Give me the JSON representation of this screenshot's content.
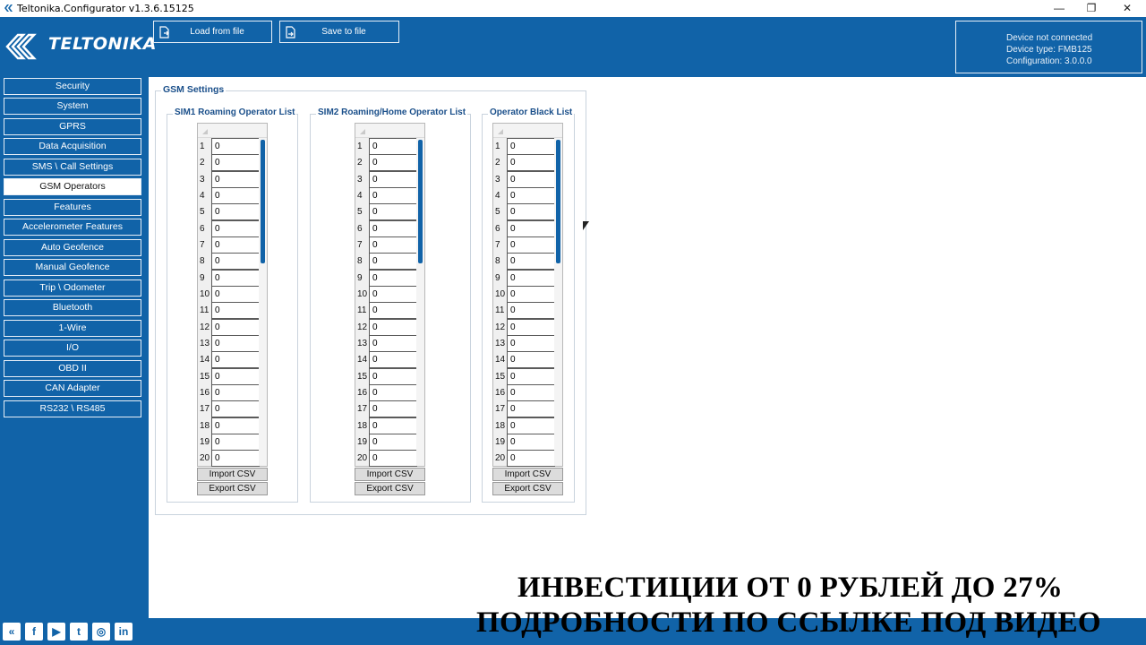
{
  "window": {
    "title": "Teltonika.Configurator v1.3.6.15125",
    "minimize": "—",
    "restore": "❐",
    "close": "✕"
  },
  "header": {
    "logo_text": "TELTONIKA",
    "load_button": "Load from file",
    "save_button": "Save to file",
    "device_status": "Device not connected",
    "device_type": "Device type: FMB125",
    "configuration": "Configuration: 3.0.0.0"
  },
  "sidebar": {
    "items": [
      {
        "label": "Security",
        "active": false
      },
      {
        "label": "System",
        "active": false
      },
      {
        "label": "GPRS",
        "active": false
      },
      {
        "label": "Data Acquisition",
        "active": false
      },
      {
        "label": "SMS \\ Call Settings",
        "active": false
      },
      {
        "label": "GSM Operators",
        "active": true
      },
      {
        "label": "Features",
        "active": false
      },
      {
        "label": "Accelerometer Features",
        "active": false
      },
      {
        "label": "Auto Geofence",
        "active": false
      },
      {
        "label": "Manual Geofence",
        "active": false
      },
      {
        "label": "Trip \\ Odometer",
        "active": false
      },
      {
        "label": "Bluetooth",
        "active": false
      },
      {
        "label": "1-Wire",
        "active": false
      },
      {
        "label": "I/O",
        "active": false
      },
      {
        "label": "OBD II",
        "active": false
      },
      {
        "label": "CAN Adapter",
        "active": false
      },
      {
        "label": "RS232 \\ RS485",
        "active": false
      }
    ]
  },
  "main": {
    "group_title": "GSM Settings",
    "lists": [
      {
        "title": "SIM1 Roaming Operator List",
        "values": [
          "0",
          "0",
          "0",
          "0",
          "0",
          "0",
          "0",
          "0",
          "0",
          "0",
          "0",
          "0",
          "0",
          "0",
          "0",
          "0",
          "0",
          "0",
          "0",
          "0"
        ],
        "import_label": "Import CSV",
        "export_label": "Export CSV"
      },
      {
        "title": "SIM2 Roaming/Home Operator List",
        "values": [
          "0",
          "0",
          "0",
          "0",
          "0",
          "0",
          "0",
          "0",
          "0",
          "0",
          "0",
          "0",
          "0",
          "0",
          "0",
          "0",
          "0",
          "0",
          "0",
          "0"
        ],
        "import_label": "Import CSV",
        "export_label": "Export CSV"
      },
      {
        "title": "Operator Black List",
        "values": [
          "0",
          "0",
          "0",
          "0",
          "0",
          "0",
          "0",
          "0",
          "0",
          "0",
          "0",
          "0",
          "0",
          "0",
          "0",
          "0",
          "0",
          "0",
          "0",
          "0"
        ],
        "import_label": "Import CSV",
        "export_label": "Export CSV"
      }
    ],
    "row_numbers": [
      "1",
      "2",
      "3",
      "4",
      "5",
      "6",
      "7",
      "8",
      "9",
      "10",
      "11",
      "12",
      "13",
      "14",
      "15",
      "16",
      "17",
      "18",
      "19",
      "20"
    ]
  },
  "footer": {
    "social": [
      {
        "icon": "teltonika-icon",
        "glyph": "«"
      },
      {
        "icon": "facebook-icon",
        "glyph": "f"
      },
      {
        "icon": "youtube-icon",
        "glyph": "▶"
      },
      {
        "icon": "twitter-icon",
        "glyph": "t"
      },
      {
        "icon": "instagram-icon",
        "glyph": "◎"
      },
      {
        "icon": "linkedin-icon",
        "glyph": "in"
      }
    ]
  },
  "overlay": {
    "line1": "ИНВЕСТИЦИИ ОТ 0 РУБЛЕЙ ДО 27%",
    "line2": "ПОДРОБНОСТИ ПО ССЫЛКЕ ПОД ВИДЕО"
  },
  "colors": {
    "brand_blue": "#1163a8",
    "title_blue": "#1a4f8a"
  }
}
